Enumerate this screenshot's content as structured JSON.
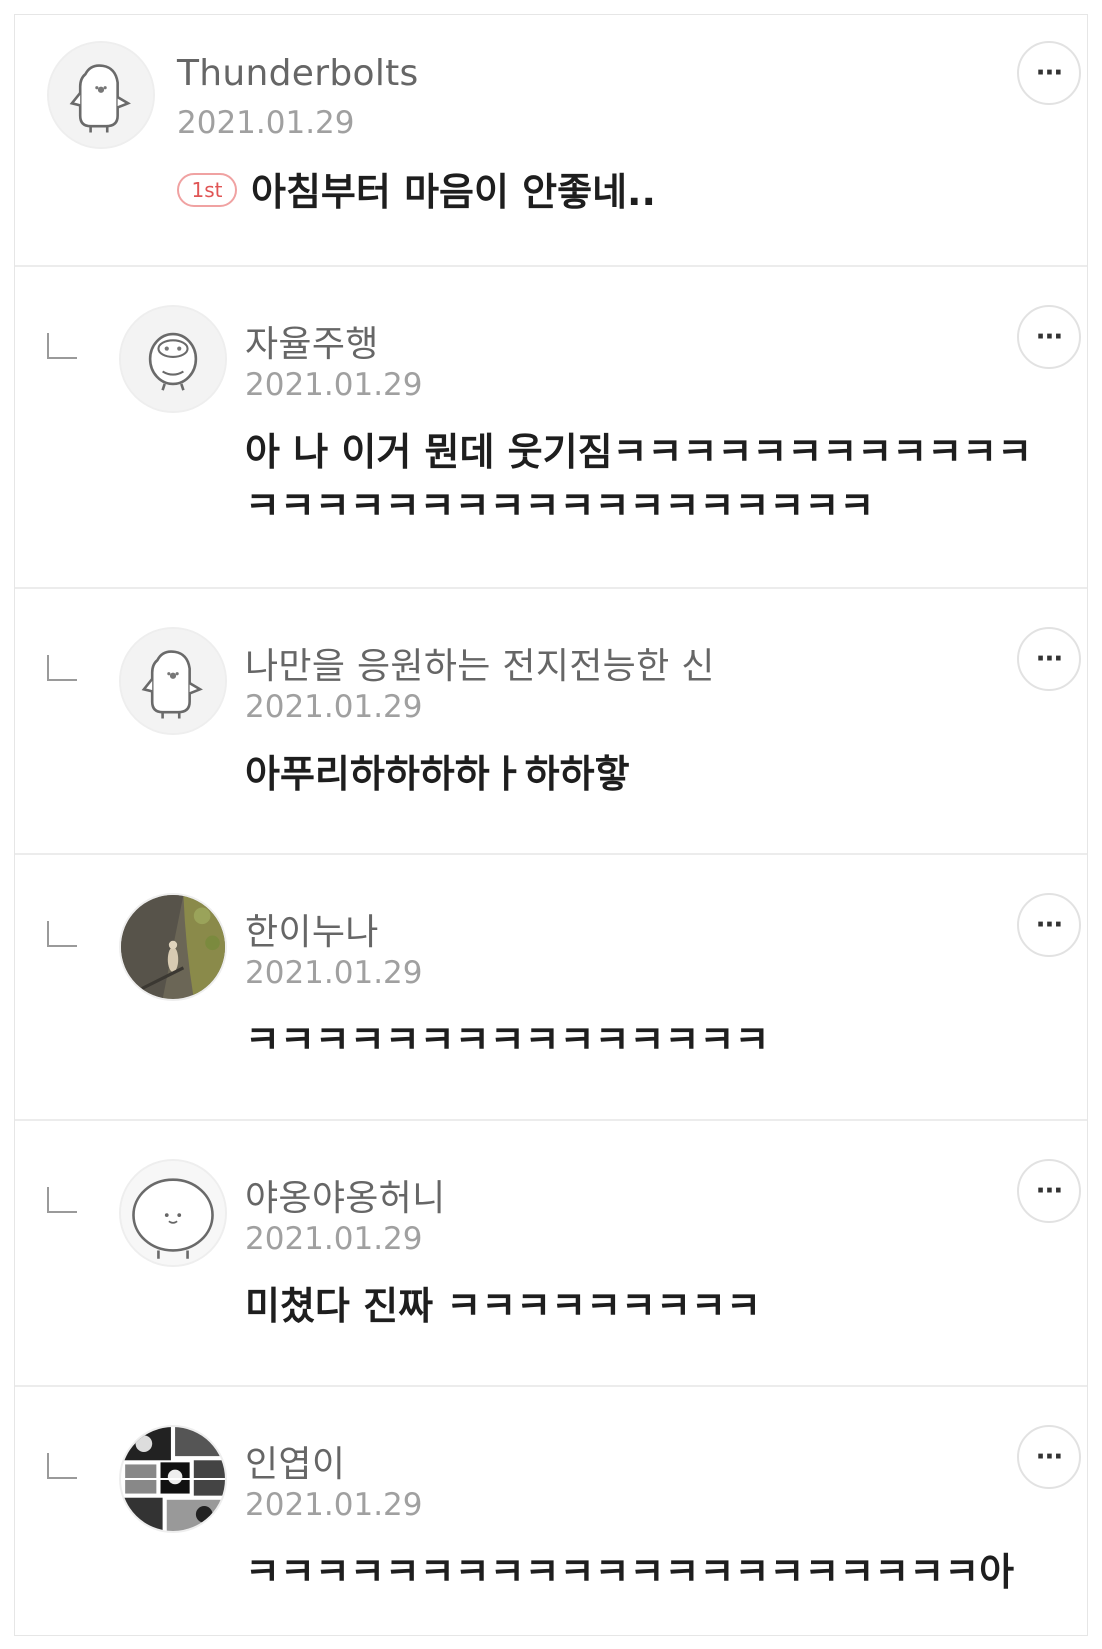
{
  "comments": [
    {
      "author": "Thunderbolts",
      "date": "2021.01.29",
      "badge": "1st",
      "text": "아침부터 마음이 안좋네..",
      "avatar": "penguin-avatar-icon",
      "more": "···"
    },
    {
      "author": "자율주행",
      "date": "2021.01.29",
      "text": "아 나 이거 뭔데 웃기짐ㅋㅋㅋㅋㅋㅋㅋㅋㅋㅋㅋㅋㅋㅋㅋㅋㅋㅋㅋㅋㅋㅋㅋㅋㅋㅋㅋㅋㅋㅋ",
      "avatar": "bird-avatar-icon",
      "more": "···"
    },
    {
      "author": "나만을 응원하는 전지전능한 신",
      "date": "2021.01.29",
      "text": "아푸리하하하하ㅏ하하핳",
      "avatar": "penguin-avatar-icon",
      "more": "···"
    },
    {
      "author": "한이누나",
      "date": "2021.01.29",
      "text": "ㅋㅋㅋㅋㅋㅋㅋㅋㅋㅋㅋㅋㅋㅋㅋ",
      "avatar": "photo-avatar",
      "more": "···"
    },
    {
      "author": "야옹야옹허니",
      "date": "2021.01.29",
      "text": "미쳤다 진짜 ㅋㅋㅋㅋㅋㅋㅋㅋㅋ",
      "avatar": "blob-avatar-icon",
      "more": "···"
    },
    {
      "author": "인엽이",
      "date": "2021.01.29",
      "text": "ㅋㅋㅋㅋㅋㅋㅋㅋㅋㅋㅋㅋㅋㅋㅋㅋㅋㅋㅋㅋㅋ아",
      "avatar": "manga-avatar",
      "more": "···"
    }
  ]
}
